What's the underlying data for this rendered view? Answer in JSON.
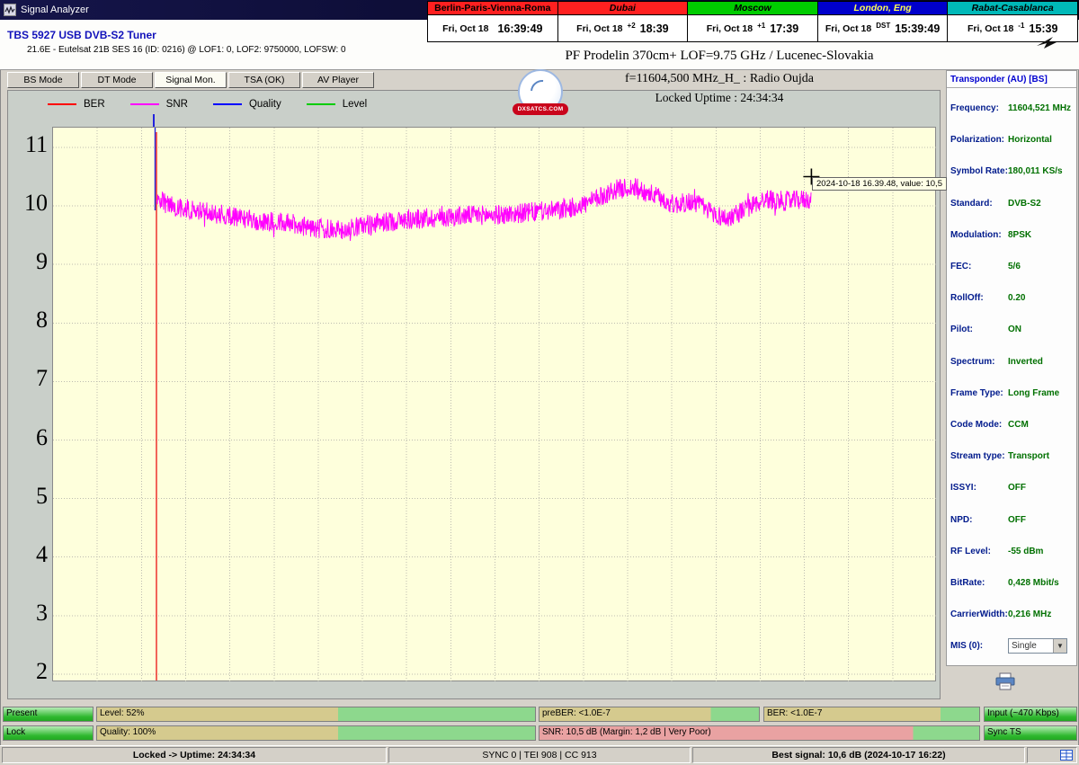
{
  "window": {
    "title": "Signal Analyzer"
  },
  "clocks": [
    {
      "city": "Berlin-Paris-Vienna-Roma",
      "bg": "#ff2020",
      "fg": "#000000",
      "italic": false,
      "date": "Fri, Oct 18",
      "offset": "",
      "time": "16:39:49"
    },
    {
      "city": "Dubai",
      "bg": "#ff2020",
      "fg": "#000000",
      "italic": true,
      "date": "Fri, Oct 18",
      "offset": "+2",
      "time": "18:39"
    },
    {
      "city": "Moscow",
      "bg": "#00cc00",
      "fg": "#000000",
      "italic": true,
      "date": "Fri, Oct 18",
      "offset": "+1",
      "time": "17:39"
    },
    {
      "city": "London, Eng",
      "bg": "#0000cc",
      "fg": "#ffff55",
      "italic": true,
      "date": "Fri, Oct 18",
      "offset": "DST",
      "time": "15:39:49"
    },
    {
      "city": "Rabat-Casablanca",
      "bg": "#00b8b8",
      "fg": "#000000",
      "italic": true,
      "date": "Fri, Oct 18",
      "offset": "-1",
      "time": "15:39"
    }
  ],
  "tuner": {
    "name": "TBS 5927 USB DVB-S2 Tuner",
    "details": "21.6E - Eutelsat 21B  SES 16 (ID: 0216) @ LOF1: 0, LOF2: 9750000, LOFSW: 0"
  },
  "header": {
    "antenna": "PF Prodelin 370cm+ LOF=9.75 GHz / Lucenec-Slovakia",
    "frequency": "f=11604,500 MHz_H_ : Radio Oujda",
    "uptime": "Locked Uptime : 24:34:34"
  },
  "logo": {
    "text": "DXSATCS.COM"
  },
  "tabs": [
    {
      "label": "BS Mode",
      "active": false
    },
    {
      "label": "DT Mode",
      "active": false
    },
    {
      "label": "Signal Mon.",
      "active": true
    },
    {
      "label": "TSA (OK)",
      "active": false
    },
    {
      "label": "AV Player",
      "active": false
    }
  ],
  "legend": [
    {
      "label": "BER",
      "color": "#ff0000"
    },
    {
      "label": "SNR",
      "color": "#ff00ff"
    },
    {
      "label": "Quality",
      "color": "#0000ff"
    },
    {
      "label": "Level",
      "color": "#00cc00"
    }
  ],
  "chart_data": {
    "type": "line",
    "title": "",
    "xlabel": "",
    "ylabel": "",
    "ylim": [
      1.8,
      11.4
    ],
    "yticks": [
      11,
      10,
      9,
      8,
      7,
      6,
      5,
      4,
      3,
      2
    ],
    "grid": true,
    "plot_background": "#feffdc",
    "legend_position": "top-left",
    "x_window": {
      "start_frac": 0.117,
      "end_frac": 0.858
    },
    "cursor": {
      "x_frac": 0.858,
      "value_db": 10.5
    },
    "series": [
      {
        "name": "SNR",
        "color": "#ff00ff",
        "noise_db": 0.17,
        "points": [
          [
            0,
            10.1
          ],
          [
            0.03,
            9.98
          ],
          [
            0.07,
            9.9
          ],
          [
            0.12,
            9.82
          ],
          [
            0.16,
            9.72
          ],
          [
            0.2,
            9.72
          ],
          [
            0.24,
            9.62
          ],
          [
            0.28,
            9.58
          ],
          [
            0.33,
            9.7
          ],
          [
            0.38,
            9.76
          ],
          [
            0.43,
            9.8
          ],
          [
            0.48,
            9.84
          ],
          [
            0.53,
            9.85
          ],
          [
            0.58,
            9.9
          ],
          [
            0.62,
            9.93
          ],
          [
            0.66,
            10.05
          ],
          [
            0.7,
            10.28
          ],
          [
            0.73,
            10.32
          ],
          [
            0.76,
            10.18
          ],
          [
            0.79,
            10.02
          ],
          [
            0.82,
            10.08
          ],
          [
            0.85,
            9.88
          ],
          [
            0.87,
            9.78
          ],
          [
            0.9,
            9.95
          ],
          [
            0.93,
            10.12
          ],
          [
            0.96,
            10.08
          ],
          [
            1,
            10.12
          ]
        ]
      },
      {
        "name": "BER",
        "color": "#ee2222",
        "vertical_line_at_start": true
      },
      {
        "name": "Quality",
        "color": "#2222dd",
        "vertical_line_at_start": true
      },
      {
        "name": "Level",
        "color": "#00cc00",
        "points": []
      }
    ]
  },
  "tooltip": {
    "text": "2024-10-18 16.39.48, value: 10,5"
  },
  "transponder": {
    "title": "Transponder (AU) [BS]",
    "rows": [
      {
        "label": "Frequency:",
        "value": "11604,521 MHz"
      },
      {
        "label": "Polarization:",
        "value": "Horizontal"
      },
      {
        "label": "Symbol Rate:",
        "value": "180,011 KS/s"
      },
      {
        "label": "Standard:",
        "value": "DVB-S2"
      },
      {
        "label": "Modulation:",
        "value": "8PSK"
      },
      {
        "label": "FEC:",
        "value": "5/6"
      },
      {
        "label": "RollOff:",
        "value": "0.20"
      },
      {
        "label": "Pilot:",
        "value": "ON"
      },
      {
        "label": "Spectrum:",
        "value": "Inverted"
      },
      {
        "label": "Frame Type:",
        "value": "Long Frame"
      },
      {
        "label": "Code Mode:",
        "value": "CCM"
      },
      {
        "label": "Stream type:",
        "value": "Transport"
      },
      {
        "label": "ISSYI:",
        "value": "OFF"
      },
      {
        "label": "NPD:",
        "value": "OFF"
      },
      {
        "label": "RF Level:",
        "value": "-55 dBm"
      },
      {
        "label": "BitRate:",
        "value": "0,428 Mbit/s"
      },
      {
        "label": "CarrierWidth:",
        "value": "0,216 MHz"
      }
    ],
    "mis": {
      "label": "MIS (0):",
      "value": "Single"
    }
  },
  "status_bars": {
    "row1": [
      {
        "kind": "solid",
        "label": "Present"
      },
      {
        "kind": "split",
        "label": "Level: 52%",
        "split": 0.55,
        "left": "#d5ca8e",
        "right": "#8dd88d"
      },
      {
        "kind": "split",
        "label": "preBER: <1.0E-7",
        "split": 0.78,
        "left": "#d5ca8e",
        "right": "#8dd88d"
      },
      {
        "kind": "split",
        "label": "BER: <1.0E-7",
        "split": 0.82,
        "left": "#d5ca8e",
        "right": "#8dd88d"
      },
      {
        "kind": "solid",
        "label": "Input (~470 Kbps)"
      }
    ],
    "row2": [
      {
        "kind": "solid",
        "label": "Lock"
      },
      {
        "kind": "split",
        "label": "Quality: 100%",
        "split": 0.55,
        "left": "#d5ca8e",
        "right": "#8dd88d"
      },
      {
        "kind": "split",
        "label": "SNR: 10,5 dB (Margin: 1,2 dB | Very Poor)",
        "split": 0.85,
        "left": "#e9a2a2",
        "right": "#8dd88d"
      },
      {
        "kind": "solid",
        "label": "Sync TS"
      }
    ]
  },
  "statusbar": {
    "segments": [
      "Locked -> Uptime: 24:34:34",
      "SYNC 0 | TEI 908 | CC 913",
      "Best signal: 10,6 dB (2024-10-17 16:22)"
    ]
  }
}
